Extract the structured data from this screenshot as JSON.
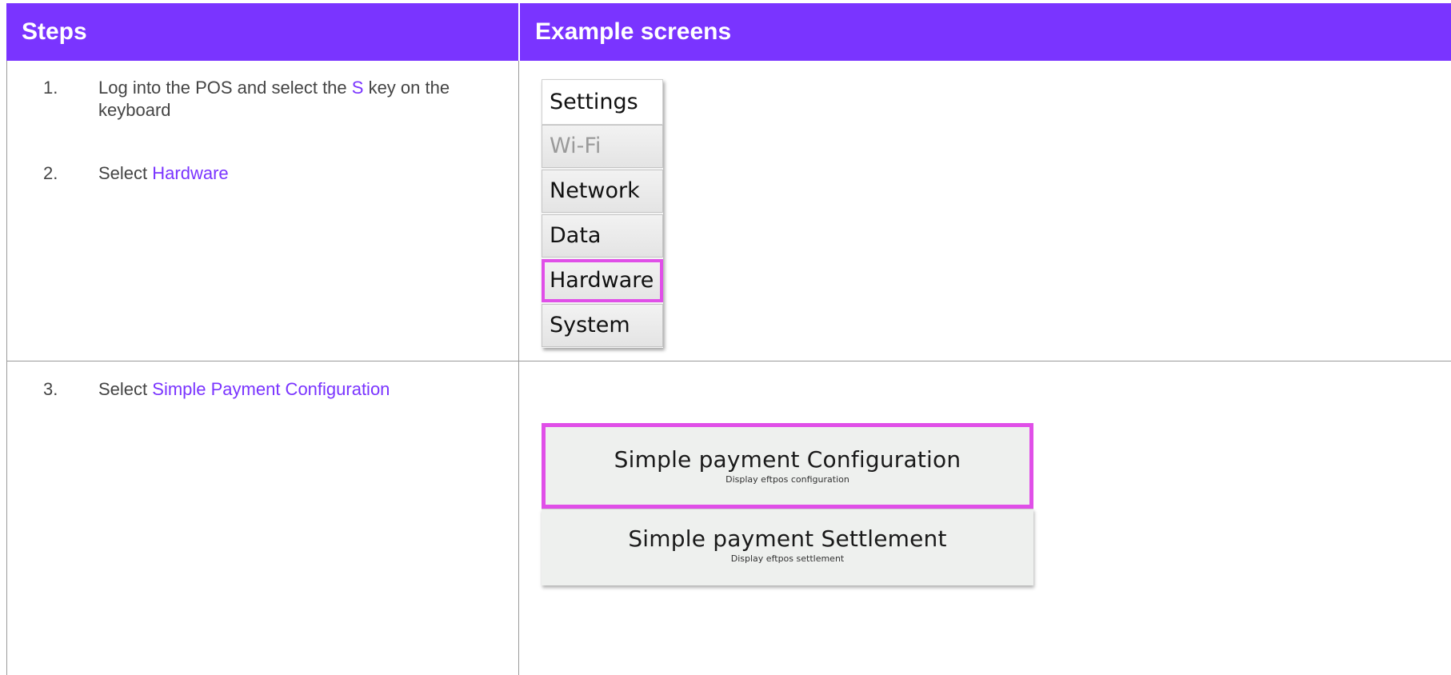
{
  "table": {
    "headers": {
      "steps": "Steps",
      "examples": "Example screens"
    },
    "steps": [
      {
        "num": "1.",
        "before": "Log into the POS and select the ",
        "highlight": "S",
        "after": " key on the keyboard"
      },
      {
        "num": "2.",
        "before": "Select ",
        "highlight": "Hardware",
        "after": ""
      },
      {
        "num": "3.",
        "before": "Select ",
        "highlight": "Simple Payment Configuration",
        "after": ""
      }
    ]
  },
  "settings_menu": {
    "title": "Settings",
    "items": [
      {
        "label": "Wi-Fi",
        "state": "disabled"
      },
      {
        "label": "Network",
        "state": "normal"
      },
      {
        "label": "Data",
        "state": "normal"
      },
      {
        "label": "Hardware",
        "state": "selected"
      },
      {
        "label": "System",
        "state": "normal"
      }
    ]
  },
  "payment_options": [
    {
      "title": "Simple payment Configuration",
      "subtitle": "Display eftpos configuration",
      "selected": true
    },
    {
      "title": "Simple payment Settlement",
      "subtitle": "Display eftpos settlement",
      "selected": false
    }
  ],
  "colors": {
    "accent": "#7a34ff",
    "highlight_border": "#e04fe8",
    "text": "#444444"
  }
}
